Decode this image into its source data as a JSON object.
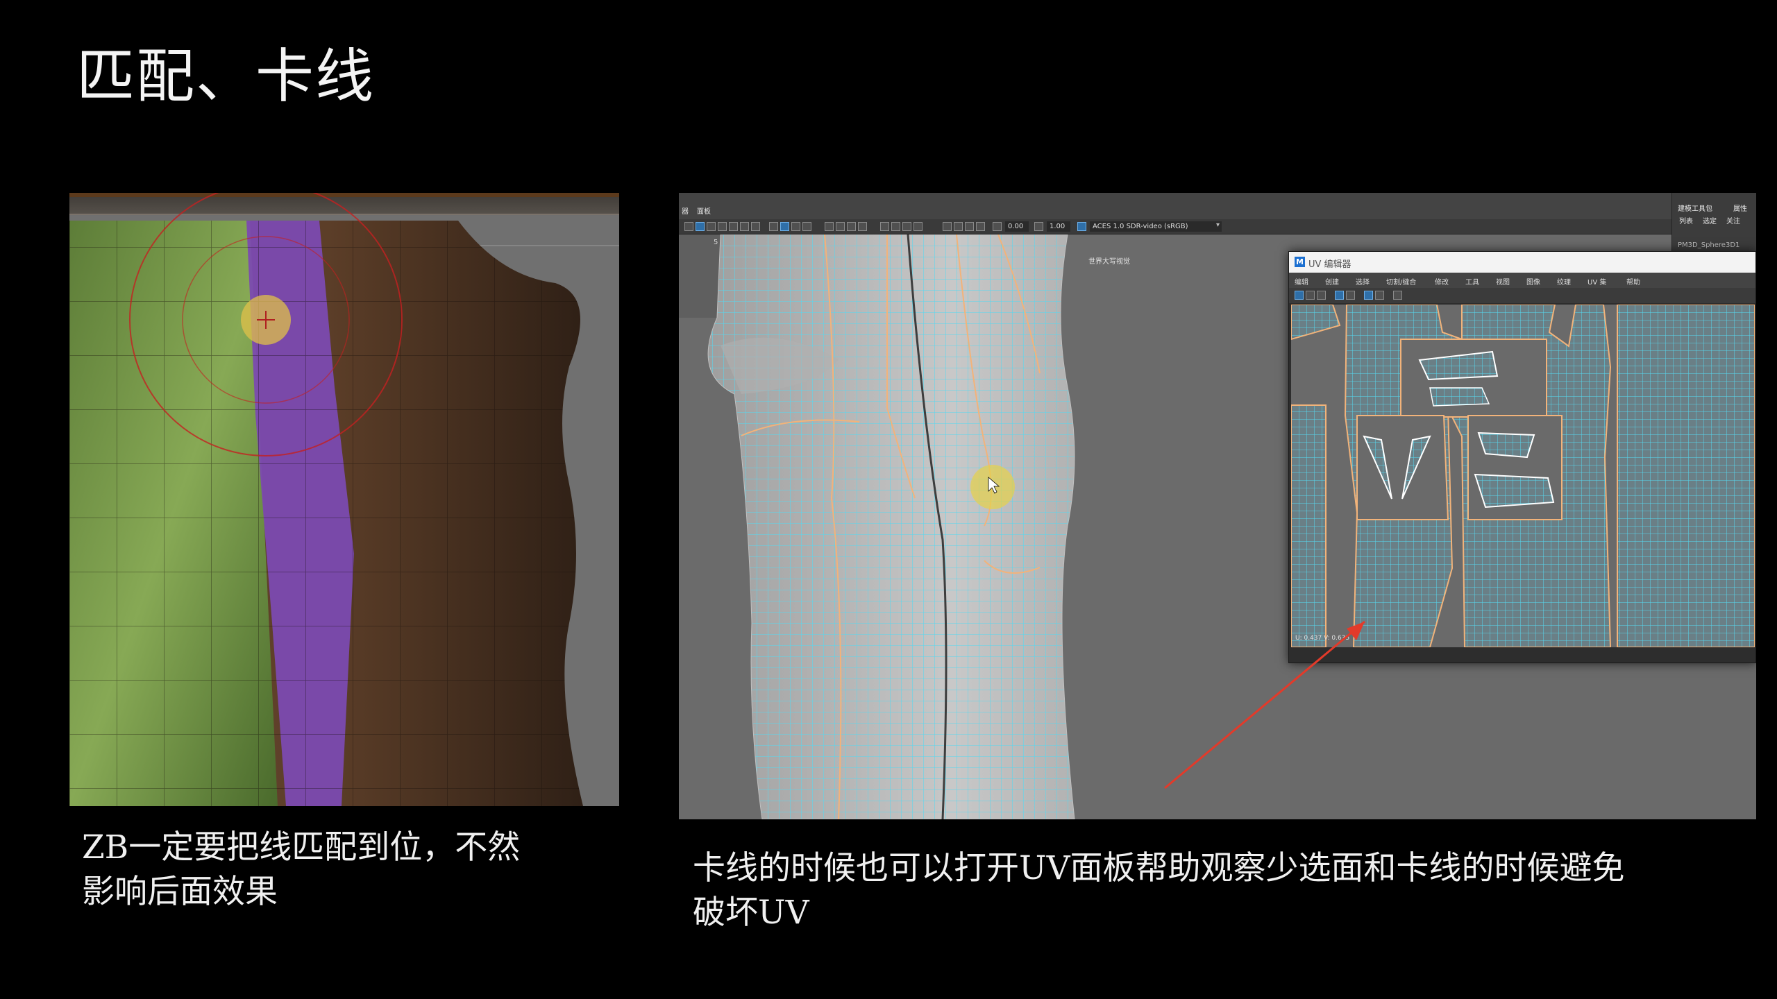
{
  "slide": {
    "title": "匹配、卡线",
    "left_caption_line1": "ZB一定要把线匹配到位，不然",
    "left_caption_line2": "影响后面效果",
    "right_caption_line1": "卡线的时候也可以打开UV面板帮助观察少选面和卡线的时候避免",
    "right_caption_line2": "破坏UV"
  },
  "maya": {
    "menubar": {
      "item1": "器",
      "item2": "面板"
    },
    "toolbar": {
      "value1": "0.00",
      "value2": "1.00",
      "colorspace": "ACES 1.0 SDR-video (sRGB)"
    },
    "hud": {
      "label": "世界大写视觉"
    },
    "side_panel": {
      "tab1": "建模工具包",
      "tab2": "属性",
      "item1": "列表",
      "item2": "选定",
      "item3": "关注",
      "object": "PM3D_Sphere3D1"
    },
    "uv_editor": {
      "title": "UV 编辑器",
      "menus": [
        "编辑",
        "创建",
        "选择",
        "切割/缝合",
        "修改",
        "工具",
        "视图",
        "图像",
        "纹理",
        "UV 集",
        "帮助"
      ],
      "coords": "U: 0.437  V: 0.635"
    }
  },
  "colors": {
    "uv_wire": "#55d8f0",
    "seam": "#f2b37a",
    "purple_strip": "#7a4aa8",
    "annotation_arrow": "#e33a2a"
  }
}
